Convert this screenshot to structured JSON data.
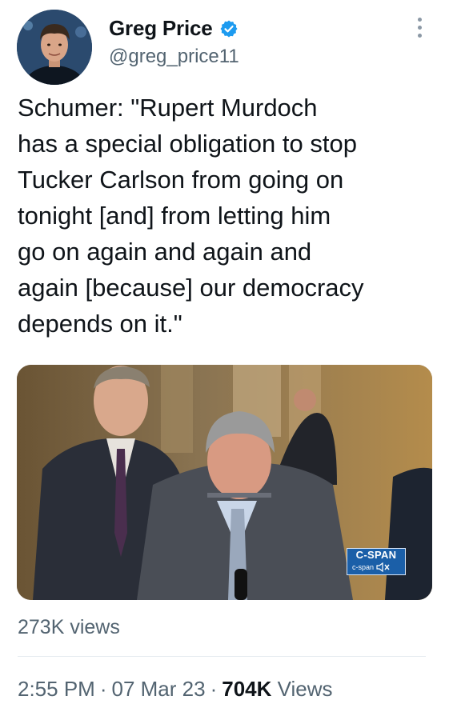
{
  "author": {
    "name": "Greg Price",
    "handle": "@greg_price11",
    "verified_color": "#1d9bf0"
  },
  "menu_icon": "more-vertical-icon",
  "tweet": {
    "text": "Schumer: \"Rupert Murdoch\nhas a special obligation to stop\nTucker Carlson from going on\ntonight [and] from letting him\ngo on again and again and\nagain [because] our democracy\ndepends on it.\""
  },
  "video": {
    "watermark_top": "C-SPAN",
    "watermark_bottom": "c-span",
    "mute_icon": "volume-muted-icon"
  },
  "video_views": "273K views",
  "meta": {
    "time": "2:55 PM",
    "date": "07 Mar 23",
    "views_count": "704K",
    "views_label": "Views"
  },
  "colors": {
    "text_primary": "#0f1419",
    "text_secondary": "#536471",
    "divider": "#e6ecf0",
    "cspan_blue": "#1b5fa8"
  }
}
